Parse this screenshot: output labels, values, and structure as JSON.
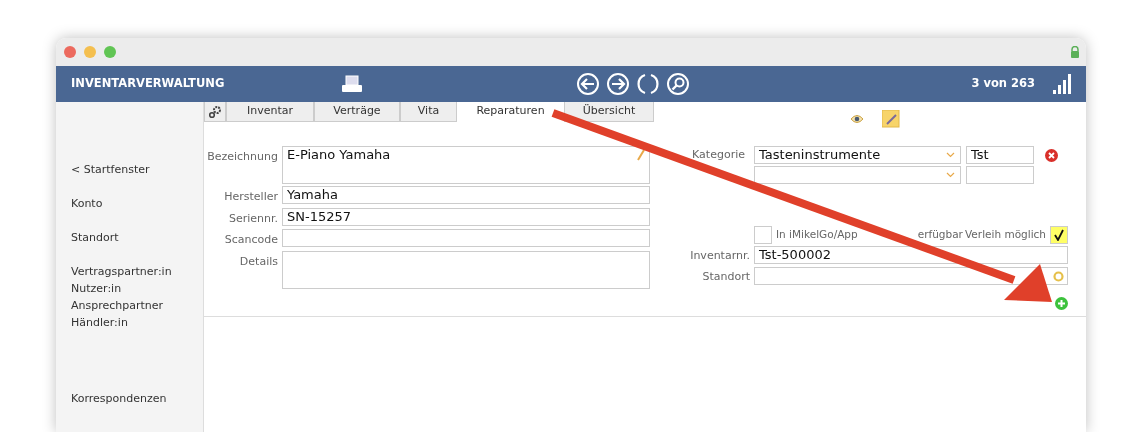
{
  "header": {
    "title": "INVENTARVERWALTUNG",
    "record_counter": "3 von 263"
  },
  "tabs": [
    {
      "label": "Inventar",
      "selected": false
    },
    {
      "label": "Verträge",
      "selected": false
    },
    {
      "label": "Vita",
      "selected": false
    },
    {
      "label": "Reparaturen",
      "selected": true
    },
    {
      "label": "Übersicht",
      "selected": false
    }
  ],
  "sidebar": {
    "groups": [
      [
        "< Startfenster"
      ],
      [
        "Konto"
      ],
      [
        "Standort"
      ],
      [
        "Vertragspartner:in",
        "Nutzer:in",
        "Ansprechpartner",
        "Händler:in"
      ],
      [
        "Korrespondenzen"
      ]
    ]
  },
  "form": {
    "left_fields": [
      {
        "label": "Bezeichnung",
        "value": "E-Piano Yamaha",
        "kind": "textarea"
      },
      {
        "label": "Hersteller",
        "value": "Yamaha",
        "kind": "text"
      },
      {
        "label": "Seriennr.",
        "value": "SN-15257",
        "kind": "text"
      },
      {
        "label": "Scancode",
        "kind": "text"
      },
      {
        "label": "Details",
        "kind": "textarea"
      }
    ],
    "category_rows": [
      {
        "label": "Kategorie",
        "value": "Tasteninstrumente",
        "code": "Tst"
      },
      {}
    ],
    "app_available": {
      "label": "In iMikelGo/App",
      "label_tail": "erfügbar",
      "checked": false
    },
    "lending_possible": {
      "label": "Verleih möglich",
      "checked": true
    },
    "right_fields": [
      {
        "label": "Inventarnr.",
        "value": "Tst-500002"
      },
      {
        "label": "Standort"
      }
    ]
  }
}
